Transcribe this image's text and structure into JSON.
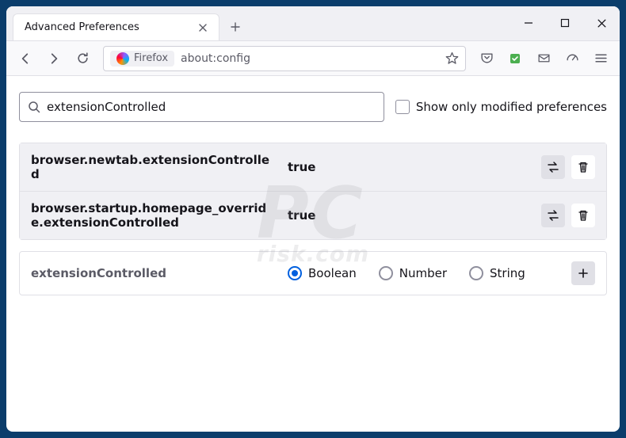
{
  "window": {
    "tab_title": "Advanced Preferences"
  },
  "urlbar": {
    "identity_label": "Firefox",
    "url": "about:config"
  },
  "search": {
    "value": "extensionControlled",
    "checkbox_label": "Show only modified preferences"
  },
  "prefs": [
    {
      "name": "browser.newtab.extensionControlled",
      "value": "true"
    },
    {
      "name": "browser.startup.homepage_override.extensionControlled",
      "value": "true"
    }
  ],
  "add_row": {
    "name": "extensionControlled",
    "types": {
      "boolean": "Boolean",
      "number": "Number",
      "string": "String"
    },
    "selected": "boolean"
  }
}
